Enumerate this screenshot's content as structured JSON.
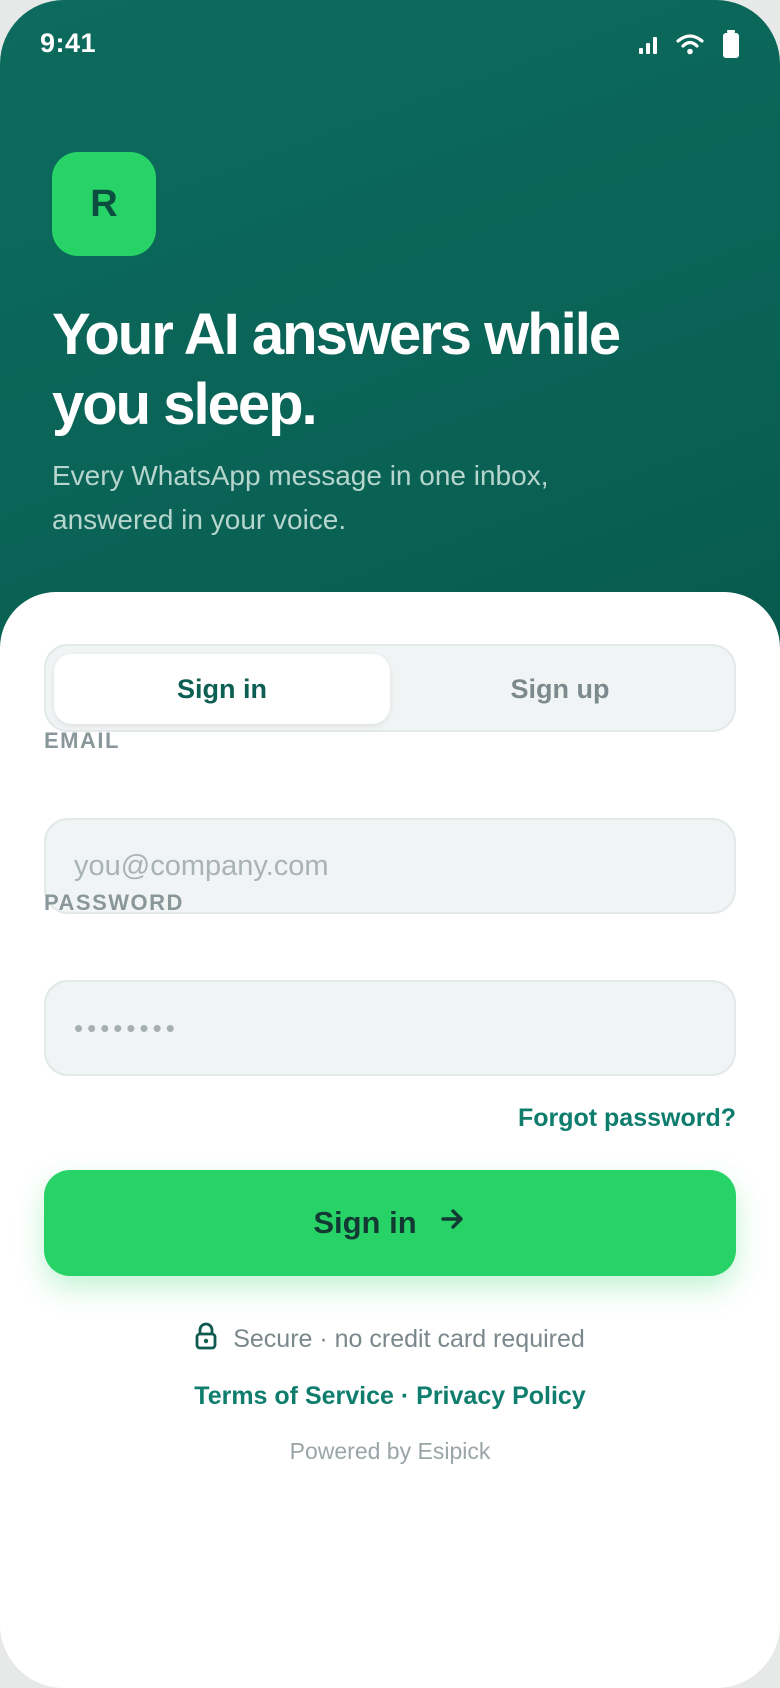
{
  "status_bar": {
    "time": "9:41",
    "icons": [
      "signal-icon",
      "wifi-icon",
      "battery-icon"
    ]
  },
  "hero": {
    "logo_letter": "R",
    "headline": "Your AI answers while you sleep.",
    "subheadline": "Every WhatsApp message in one inbox, answered in your voice."
  },
  "auth_tabs": [
    {
      "label": "Sign in",
      "active": true
    },
    {
      "label": "Sign up",
      "active": false
    }
  ],
  "form": {
    "email_label": "EMAIL",
    "email_placeholder": "you@company.com",
    "email_value": "",
    "password_label": "PASSWORD",
    "password_placeholder": "••••••••",
    "password_value": "",
    "forgot_link": "Forgot password?",
    "submit_label": "Sign in",
    "submit_icon": "arrow-right-icon"
  },
  "footer": {
    "secure_icon": "lock-icon",
    "secure_text": "Secure · no credit card required",
    "terms_link": "Terms of Service",
    "separator": "·",
    "privacy_link": "Privacy Policy",
    "powered_by": "Powered by Esipick"
  },
  "colors": {
    "hero_bg": "#0a6356",
    "accent_green": "#27d366",
    "link_teal": "#0e7d6d",
    "tab_active_text": "#0c5f52"
  }
}
